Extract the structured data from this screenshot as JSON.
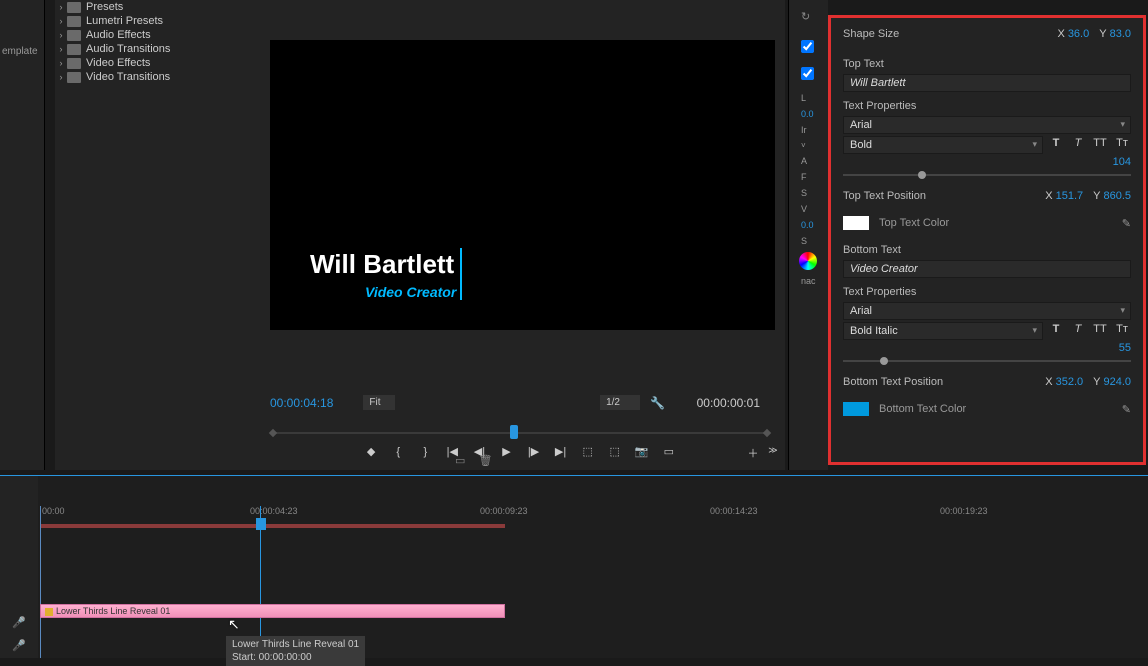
{
  "leftCol": {
    "label": "emplate"
  },
  "effects": {
    "items": [
      {
        "label": "Presets"
      },
      {
        "label": "Lumetri Presets"
      },
      {
        "label": "Audio Effects"
      },
      {
        "label": "Audio Transitions"
      },
      {
        "label": "Video Effects"
      },
      {
        "label": "Video Transitions"
      }
    ]
  },
  "preview": {
    "title": "Will Bartlett",
    "subtitle": "Video Creator",
    "tcLeft": "00:00:04:18",
    "scale": "Fit",
    "res": "1/2",
    "tcRight": "00:00:00:01"
  },
  "midCol": {
    "cb1": true,
    "cb2": true,
    "labels": [
      "L",
      "A",
      "F",
      "S",
      "V",
      "S"
    ],
    "bot": "nac",
    "num": "0.0",
    "ir": "Ir"
  },
  "panel": {
    "shapeSize": {
      "label": "Shape Size",
      "x": "36.0",
      "y": "83.0"
    },
    "topText": {
      "label": "Top Text",
      "value": "Will Bartlett"
    },
    "topProps": {
      "label": "Text Properties",
      "font": "Arial",
      "weight": "Bold",
      "size": "104"
    },
    "topPos": {
      "label": "Top Text Position",
      "x": "151.7",
      "y": "860.5"
    },
    "topColor": {
      "label": "Top Text Color",
      "hex": "#ffffff"
    },
    "botText": {
      "label": "Bottom Text",
      "value": "Video Creator"
    },
    "botProps": {
      "label": "Text Properties",
      "font": "Arial",
      "weight": "Bold Italic",
      "size": "55"
    },
    "botPos": {
      "label": "Bottom Text Position",
      "x": "352.0",
      "y": "924.0"
    },
    "botColor": {
      "label": "Bottom Text Color",
      "hex": "#0099dd"
    }
  },
  "timeline": {
    "ticks": [
      "00:00",
      "00:00:04:23",
      "00:00:09:23",
      "00:00:14:23",
      "00:00:19:23"
    ],
    "clip": "Lower Thirds Line Reveal 01",
    "tooltip1": "Lower Thirds Line Reveal 01",
    "tooltip2": "Start: 00:00:00:00"
  }
}
